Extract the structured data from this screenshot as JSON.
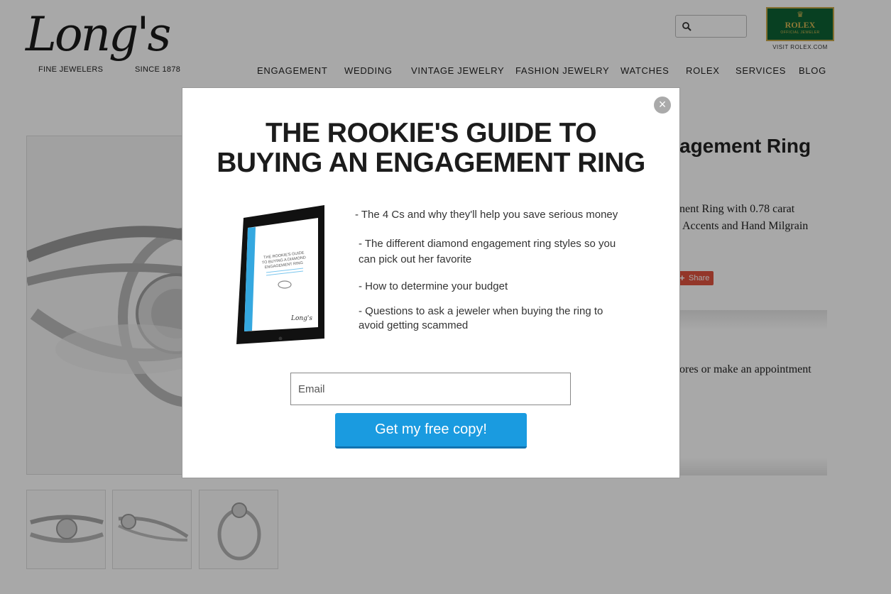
{
  "header": {
    "logo": {
      "script": "Long's",
      "left_text": "FINE JEWELERS",
      "right_text": "SINCE 1878"
    },
    "search": {
      "placeholder": "",
      "icon": "search-icon"
    },
    "rolex_badge": {
      "name": "ROLEX",
      "sub": "OFFICIAL JEWELER",
      "link": "VISIT ROLEX.COM"
    },
    "nav": [
      {
        "label": "ENGAGEMENT"
      },
      {
        "label": "WEDDING"
      },
      {
        "label": "VINTAGE JEWELRY"
      },
      {
        "label": "FASHION JEWELRY"
      },
      {
        "label": "WATCHES"
      },
      {
        "label": "ROLEX"
      },
      {
        "label": "SERVICES"
      },
      {
        "label": "BLOG"
      }
    ]
  },
  "product": {
    "title_visible": "agement Ring",
    "desc_line1": "nent Ring with 0.78 carat",
    "desc_line2": "Accents and Hand Milgrain",
    "share_label": "Share",
    "appointment_visible": "ores or make an appointment"
  },
  "modal": {
    "title_line1": "THE ROOKIE'S GUIDE TO",
    "title_line2": "BUYING AN ENGAGEMENT RING",
    "close_glyph": "×",
    "ebook": {
      "title_line1": "THE ROOKIE'S GUIDE",
      "title_line2": "TO BUYING A DIAMOND",
      "title_line3": "ENGAGEMENT RING",
      "brand": "Long's"
    },
    "bullets": [
      {
        "line1": "- The 4 Cs and why they'll help you save serious money",
        "line2": ""
      },
      {
        "line1": "- The different diamond engagement ring styles so you",
        "line2": "can pick out her favorite"
      },
      {
        "line1": "- How to determine your budget",
        "line2": ""
      },
      {
        "line1": "- Questions to ask a jeweler when buying the ring to",
        "line2": "avoid getting scammed"
      }
    ],
    "email_placeholder": "Email",
    "cta_label": "Get my free copy!"
  },
  "colors": {
    "cta": "#1a9be0",
    "overlay": "rgba(0,0,0,0.34)",
    "rolex_green": "#0d6235",
    "share_red": "#e0533f"
  }
}
